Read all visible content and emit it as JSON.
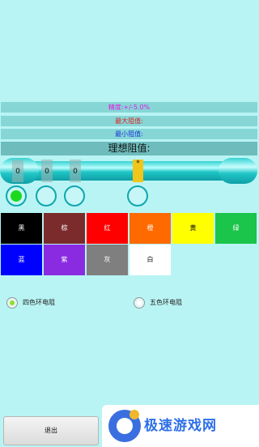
{
  "info": {
    "precision": "精度:+/-5.0%",
    "max_value": "最大阻值:",
    "min_value": "最小阻值:",
    "ideal_value": "理想阻值:"
  },
  "colors": {
    "precision_text": "#E21BE2",
    "max_text": "#E02020",
    "min_text": "#1A33D9",
    "ideal_text": "#111111",
    "selected_ring_dot": "#1CD91C",
    "tolerance_band": "#F2C51A"
  },
  "resistor": {
    "bands": [
      {
        "label": "0"
      },
      {
        "label": "0"
      },
      {
        "label": "0"
      },
      {
        "label": "*"
      }
    ]
  },
  "color_palette": [
    {
      "name": "黑",
      "bg": "#000000",
      "fg": "#FFFFFF"
    },
    {
      "name": "棕",
      "bg": "#7B2B2B",
      "fg": "#FFFFFF"
    },
    {
      "name": "红",
      "bg": "#FF0000",
      "fg": "#FFFFFF"
    },
    {
      "name": "橙",
      "bg": "#FF6A00",
      "fg": "#FFFFFF"
    },
    {
      "name": "黄",
      "bg": "#FFFF00",
      "fg": "#111111"
    },
    {
      "name": "绿",
      "bg": "#1BC44A",
      "fg": "#FFFFFF"
    },
    {
      "name": "蓝",
      "bg": "#0000FF",
      "fg": "#FFFFFF"
    },
    {
      "name": "紫",
      "bg": "#8A2BE2",
      "fg": "#FFFFFF"
    },
    {
      "name": "灰",
      "bg": "#7F7F7F",
      "fg": "#FFFFFF"
    },
    {
      "name": "白",
      "bg": "#FFFFFF",
      "fg": "#111111"
    }
  ],
  "options": {
    "four_band": "四色环电阻",
    "five_band": "五色环电阻",
    "selected": "four_band"
  },
  "footer": {
    "exit_label": "退出",
    "brand_text": "极速游戏网"
  }
}
